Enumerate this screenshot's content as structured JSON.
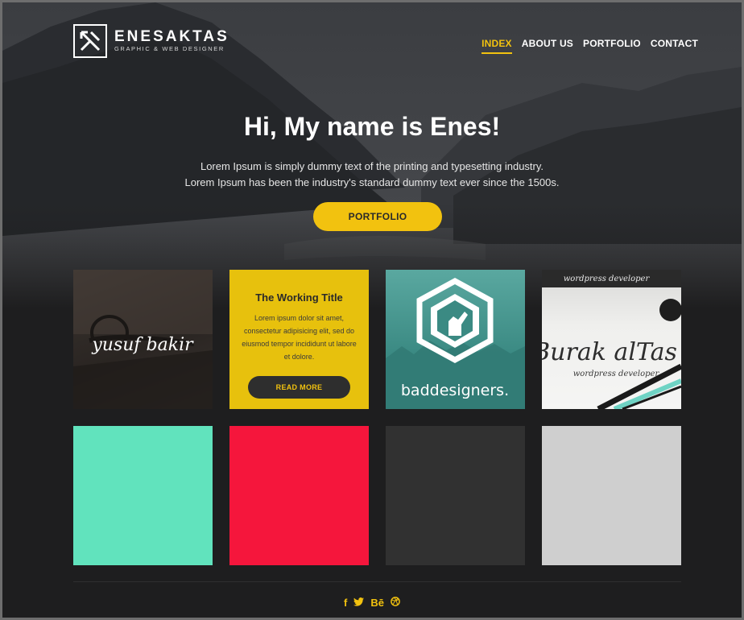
{
  "brand": {
    "name": "ENESAKTAS",
    "tagline": "GRAPHIC & WEB DESIGNER"
  },
  "nav": {
    "items": [
      {
        "label": "INDEX",
        "active": true
      },
      {
        "label": "ABOUT US",
        "active": false
      },
      {
        "label": "PORTFOLIO",
        "active": false
      },
      {
        "label": "CONTACT",
        "active": false
      }
    ]
  },
  "hero": {
    "title": "Hi, My name is Enes!",
    "line1": "Lorem Ipsum is simply dummy text of the printing and typesetting industry.",
    "line2": "Lorem Ipsum has been the industry's standard dummy text ever since the 1500s.",
    "button_label": "PORTFOLIO"
  },
  "portfolio": {
    "tile1_text": "yusuf bakir",
    "card": {
      "title": "The Working Title",
      "body": "Lorem ipsum dolor sit amet, consectetur adipisicing elit, sed do eiusmod tempor incididunt ut labore et dolore.",
      "button_label": "READ MORE"
    },
    "tile3_text": "baddesigners.",
    "tile4_top": "wordpress developer",
    "tile4_main": "Burak alTas",
    "tile4_sub": "wordpress developer",
    "swatches": [
      {
        "color": "#61e3bd"
      },
      {
        "color": "#f5163c"
      },
      {
        "color": "#313131"
      },
      {
        "color": "#cfcfcf"
      }
    ]
  },
  "footer": {
    "social": [
      {
        "icon": "facebook-icon",
        "glyph": "f"
      },
      {
        "icon": "twitter-icon",
        "glyph": "t"
      },
      {
        "icon": "behance-icon",
        "glyph": "Bē"
      },
      {
        "icon": "dribbble-icon",
        "glyph": "d"
      }
    ]
  },
  "colors": {
    "accent": "#f2c20f",
    "background": "#1e1e1f"
  }
}
